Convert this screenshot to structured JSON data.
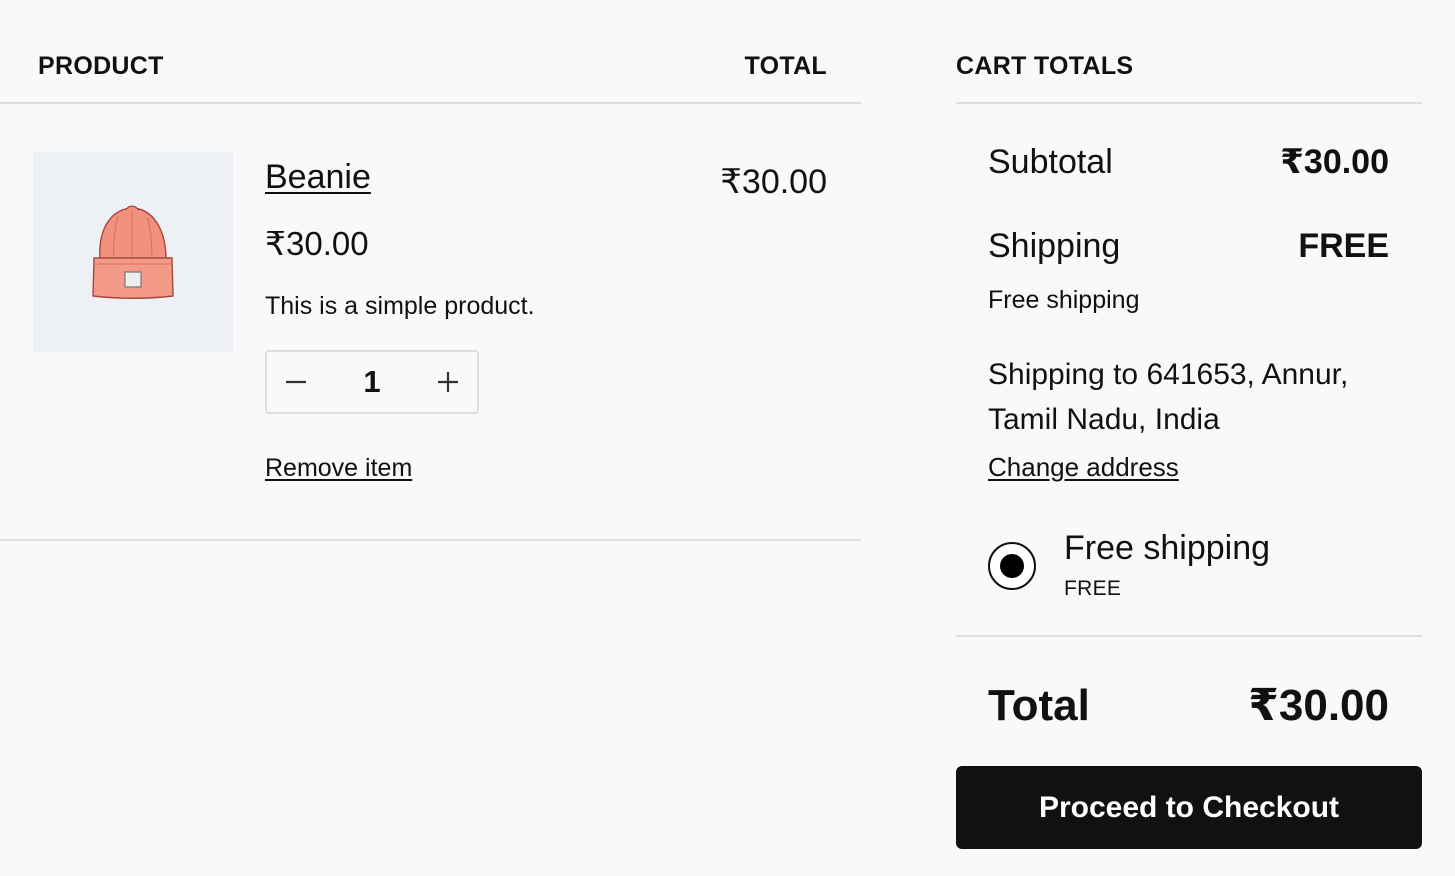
{
  "cart_table": {
    "header": {
      "product": "PRODUCT",
      "total": "TOTAL"
    },
    "items": [
      {
        "name": "Beanie",
        "unit_price": "₹30.00",
        "description": "This is a simple product.",
        "quantity": "1",
        "remove_label": "Remove item",
        "line_total": "₹30.00",
        "thumbnail_icon": "beanie-hat-image"
      }
    ]
  },
  "cart_totals": {
    "title": "CART TOTALS",
    "subtotal": {
      "label": "Subtotal",
      "value": "₹30.00"
    },
    "shipping": {
      "label": "Shipping",
      "value": "FREE",
      "method": "Free shipping",
      "destination": "Shipping to 641653, Annur, Tamil Nadu, India",
      "change_address": "Change address",
      "options": [
        {
          "label": "Free shipping",
          "price": "FREE",
          "selected": true
        }
      ]
    },
    "total": {
      "label": "Total",
      "value": "₹30.00"
    },
    "checkout_button": "Proceed to Checkout"
  },
  "colors": {
    "background": "#f9f9f9",
    "text": "#111111",
    "divider": "#dedede",
    "thumbnail_bg": "#edf0f4",
    "button_bg": "#111111",
    "button_text": "#ffffff",
    "beanie": "#f2907e"
  }
}
